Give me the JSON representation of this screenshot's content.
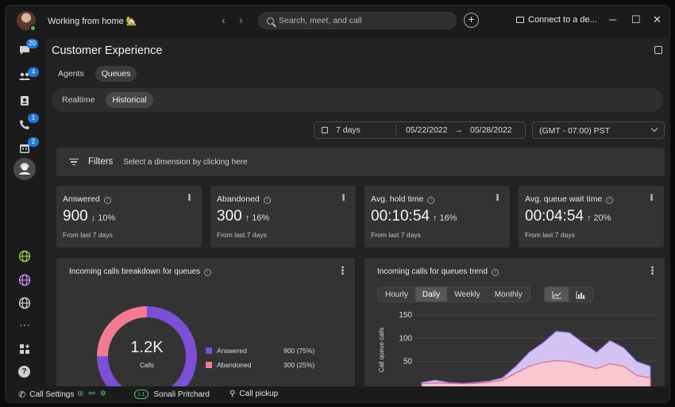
{
  "titlebar": {
    "status": "Working from home 🏡",
    "search_placeholder": "Search, meet, and call",
    "plus": "+",
    "connect": "Connect to a de...",
    "minimize": "─",
    "maximize": "☐",
    "close": "✕",
    "back": "‹",
    "forward": "›"
  },
  "rail": {
    "badges": {
      "messaging": "20",
      "teams": "4",
      "calling": "1",
      "meetings": "2"
    },
    "more": "···",
    "help": "?"
  },
  "page": {
    "title": "Customer Experience",
    "tabs": [
      {
        "label": "Agents",
        "active": false
      },
      {
        "label": "Queues",
        "active": true
      }
    ],
    "subtabs": [
      {
        "label": "Realtime",
        "active": false
      },
      {
        "label": "Historical",
        "active": true
      }
    ]
  },
  "date_range": {
    "preset": "7 days",
    "start": "05/22/2022",
    "end": "05/28/2022",
    "arrow": "→",
    "timezone": "(GMT - 07:00) PST"
  },
  "filters": {
    "label": "Filters",
    "hint": "Select a dimension by clicking here"
  },
  "kpis": [
    {
      "title": "Answered",
      "value": "900",
      "arrow": "↓",
      "delta": "10%",
      "foot": "From last 7 days"
    },
    {
      "title": "Abandoned",
      "value": "300",
      "arrow": "↑",
      "delta": "16%",
      "foot": "From last 7 days"
    },
    {
      "title": "Avg. hold time",
      "value": "00:10:54",
      "arrow": "↑",
      "delta": "16%",
      "foot": "From last 7 days"
    },
    {
      "title": "Avg. queue wait time",
      "value": "00:04:54",
      "arrow": "↑",
      "delta": "20%",
      "foot": "From last 7 days"
    }
  ],
  "breakdown": {
    "title": "Incoming calls breakdown for queues",
    "center_value": "1.2K",
    "center_label": "Calls",
    "legend": [
      {
        "label": "Answered",
        "value": "900 (75%)",
        "color": "#7b4fd6"
      },
      {
        "label": "Abandoned",
        "value": "300 (25%)",
        "color": "#f47a93"
      }
    ]
  },
  "trend": {
    "title": "Incoming calls for queues trend",
    "granularity": [
      {
        "label": "Hourly",
        "active": false
      },
      {
        "label": "Daily",
        "active": true
      },
      {
        "label": "Weekly",
        "active": false
      },
      {
        "label": "Monthly",
        "active": false
      }
    ],
    "view_line_icon": "line-chart-icon",
    "view_bar_icon": "bar-chart-icon"
  },
  "chart_data": [
    {
      "type": "pie",
      "labels": [
        "Answered",
        "Abandoned"
      ],
      "values": [
        900,
        300
      ],
      "colors": [
        "#7b4fd6",
        "#f47a93"
      ]
    },
    {
      "type": "area",
      "ylabel": "Call queue calls",
      "ylim": [
        0,
        150
      ],
      "yticks": [
        50,
        100,
        150
      ],
      "series": [
        {
          "values": [
            5,
            10,
            5,
            3,
            5,
            8,
            15,
            40,
            70,
            90,
            115,
            112,
            90,
            70,
            95,
            80,
            50,
            40
          ],
          "color": "#d3c3f5"
        },
        {
          "values": [
            2,
            4,
            3,
            2,
            3,
            5,
            10,
            25,
            40,
            48,
            52,
            50,
            42,
            35,
            45,
            40,
            20,
            15
          ],
          "color": "#f8c7cf"
        }
      ]
    }
  ],
  "bottombar": {
    "call_settings": "Call Settings",
    "line_tag": "L1",
    "line_name": "Sonali Pritchard",
    "call_pickup": "Call pickup"
  }
}
